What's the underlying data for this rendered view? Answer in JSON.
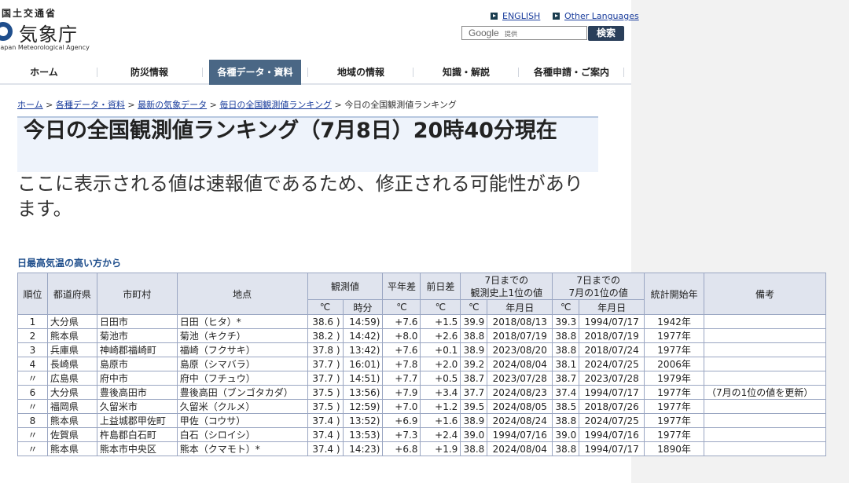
{
  "header": {
    "ministry": "国土交通省",
    "agency": "気象庁",
    "agency_en": "Japan Meteorological Agency",
    "lang_english": "ENGLISH",
    "lang_other": "Other Languages",
    "search_google": "Google",
    "search_google_sub": "提供",
    "search_button": "検索"
  },
  "nav": [
    "ホーム",
    "防災情報",
    "各種データ・資料",
    "地域の情報",
    "知識・解説",
    "各種申請・ご案内"
  ],
  "breadcrumb": {
    "items": [
      "ホーム",
      "各種データ・資料",
      "最新の気象データ",
      "毎日の全国観測値ランキング"
    ],
    "current": "今日の全国観測値ランキング",
    "sep": ">"
  },
  "page_title": "今日の全国観測値ランキング（7月8日）20時40分現在",
  "notice": "ここに表示される値は速報値であるため、修正される可能性があります。",
  "table_caption": "日最高気温の高い方から",
  "table": {
    "headers": {
      "rank": "順位",
      "pref": "都道府県",
      "city": "市町村",
      "station": "地点",
      "observed": "観測値",
      "normal_diff": "平年差",
      "prev_diff": "前日差",
      "record_to_date": "7日までの\n観測史上1位の値",
      "july_to_date": "7日までの\n7月の1位の値",
      "stats_start": "統計開始年",
      "remarks": "備考"
    },
    "subheaders": {
      "obs_unit": "℃",
      "obs_time": "時分",
      "normal_unit": "℃",
      "prev_unit": "℃",
      "rec_unit": "℃",
      "rec_date": "年月日",
      "jul_unit": "℃",
      "jul_date": "年月日"
    },
    "rows": [
      {
        "rank": "1",
        "pref": "大分県",
        "city": "日田市",
        "station": "日田（ヒタ）*",
        "val": "38.6 )",
        "time": "14:59)",
        "normal": "+7.6",
        "prev": "+1.5",
        "rec": "39.9",
        "rec_date": "2018/08/13",
        "jul": "39.3",
        "jul_date": "1994/07/17",
        "start": "1942年",
        "remark": ""
      },
      {
        "rank": "2",
        "pref": "熊本県",
        "city": "菊池市",
        "station": "菊池（キクチ）",
        "val": "38.2 )",
        "time": "14:42)",
        "normal": "+8.0",
        "prev": "+2.6",
        "rec": "38.8",
        "rec_date": "2018/07/19",
        "jul": "38.8",
        "jul_date": "2018/07/19",
        "start": "1977年",
        "remark": ""
      },
      {
        "rank": "3",
        "pref": "兵庫県",
        "city": "神崎郡福崎町",
        "station": "福崎（フクサキ）",
        "val": "37.8 )",
        "time": "13:42)",
        "normal": "+7.6",
        "prev": "+0.1",
        "rec": "38.9",
        "rec_date": "2023/08/20",
        "jul": "38.8",
        "jul_date": "2018/07/24",
        "start": "1977年",
        "remark": ""
      },
      {
        "rank": "4",
        "pref": "長崎県",
        "city": "島原市",
        "station": "島原（シマバラ）",
        "val": "37.7 )",
        "time": "16:01)",
        "normal": "+7.8",
        "prev": "+2.0",
        "rec": "39.2",
        "rec_date": "2024/08/04",
        "jul": "38.1",
        "jul_date": "2024/07/25",
        "start": "2006年",
        "remark": ""
      },
      {
        "rank": "〃",
        "pref": "広島県",
        "city": "府中市",
        "station": "府中（フチュウ）",
        "val": "37.7 )",
        "time": "14:51)",
        "normal": "+7.7",
        "prev": "+0.5",
        "rec": "38.7",
        "rec_date": "2023/07/28",
        "jul": "38.7",
        "jul_date": "2023/07/28",
        "start": "1979年",
        "remark": ""
      },
      {
        "rank": "6",
        "pref": "大分県",
        "city": "豊後高田市",
        "station": "豊後高田（ブンゴタカダ）",
        "val": "37.5 )",
        "time": "13:56)",
        "normal": "+7.9",
        "prev": "+3.4",
        "rec": "37.7",
        "rec_date": "2024/08/23",
        "jul": "37.4",
        "jul_date": "1994/07/17",
        "start": "1977年",
        "remark": "（7月の1位の値を更新）"
      },
      {
        "rank": "〃",
        "pref": "福岡県",
        "city": "久留米市",
        "station": "久留米（クルメ）",
        "val": "37.5 )",
        "time": "12:59)",
        "normal": "+7.0",
        "prev": "+1.2",
        "rec": "39.5",
        "rec_date": "2024/08/05",
        "jul": "38.5",
        "jul_date": "2018/07/26",
        "start": "1977年",
        "remark": ""
      },
      {
        "rank": "8",
        "pref": "熊本県",
        "city": "上益城郡甲佐町",
        "station": "甲佐（コウサ）",
        "val": "37.4 )",
        "time": "13:52)",
        "normal": "+6.9",
        "prev": "+1.6",
        "rec": "38.9",
        "rec_date": "2024/08/24",
        "jul": "38.8",
        "jul_date": "2024/07/25",
        "start": "1977年",
        "remark": ""
      },
      {
        "rank": "〃",
        "pref": "佐賀県",
        "city": "杵島郡白石町",
        "station": "白石（シロイシ）",
        "val": "37.4 )",
        "time": "13:53)",
        "normal": "+7.3",
        "prev": "+2.4",
        "rec": "39.0",
        "rec_date": "1994/07/16",
        "jul": "39.0",
        "jul_date": "1994/07/16",
        "start": "1977年",
        "remark": ""
      },
      {
        "rank": "〃",
        "pref": "熊本県",
        "city": "熊本市中央区",
        "station": "熊本（クマモト）*",
        "val": "37.4 )",
        "time": "14:23)",
        "normal": "+6.8",
        "prev": "+1.9",
        "rec": "38.8",
        "rec_date": "2024/08/04",
        "jul": "38.8",
        "jul_date": "1994/07/17",
        "start": "1890年",
        "remark": ""
      }
    ]
  }
}
